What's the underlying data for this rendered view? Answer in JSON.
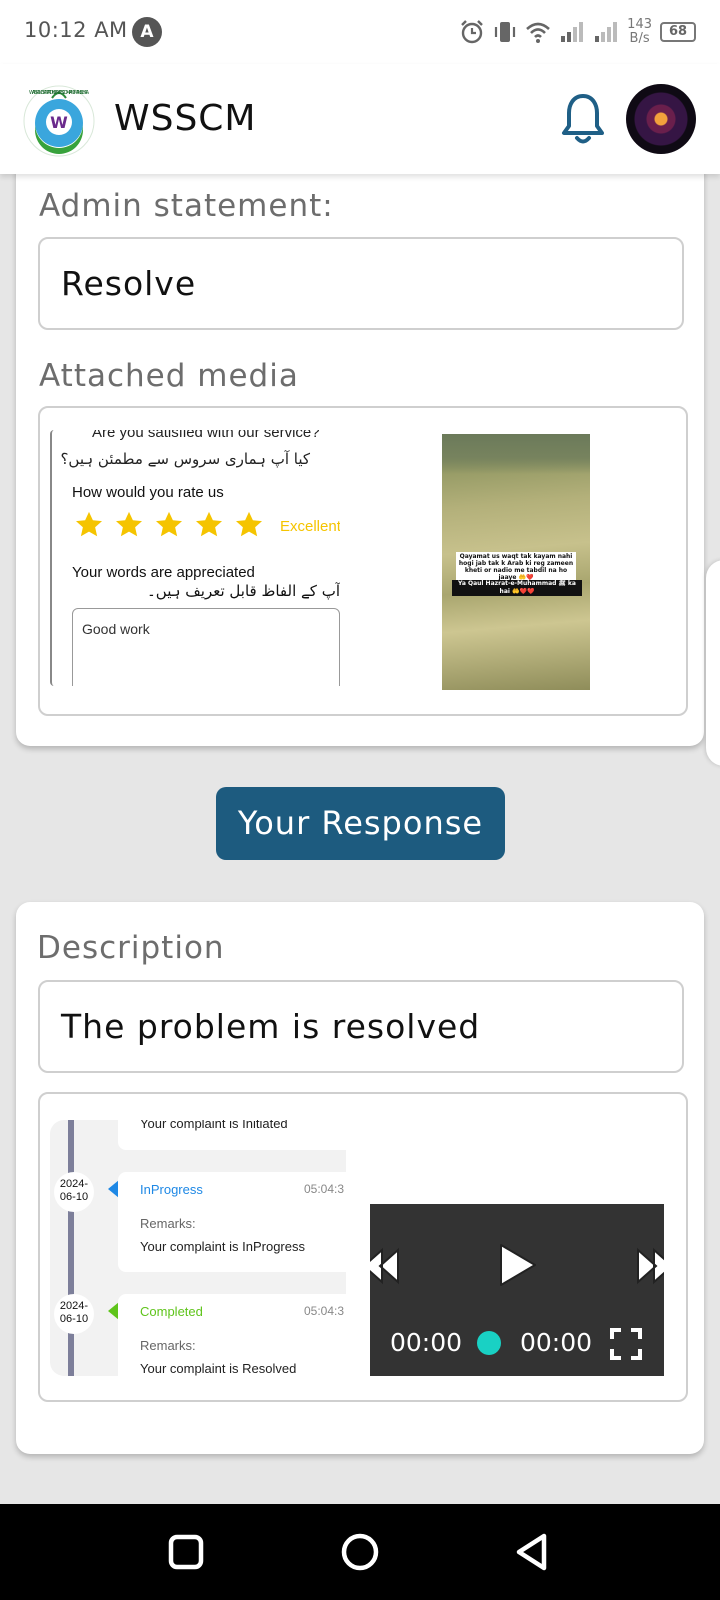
{
  "status_bar": {
    "time": "10:12 AM",
    "notification_letter": "A",
    "net_speed_value": "143",
    "net_speed_unit": "B/s",
    "battery": "68"
  },
  "app_bar": {
    "title": "WSSCM",
    "logo_letter": "W",
    "logo_ring_text": "WATER AND SANITATION SERVICES COMPANY MANSEHRA"
  },
  "complaint": {
    "admin_statement_label": "Admin statement:",
    "admin_statement_value": "Resolve",
    "attached_media_label": "Attached media"
  },
  "rating_screenshot": {
    "question": "Are you satisfied with our service?",
    "question_urdu": "کیا آپ ہماری سروس سے مطمئن ہیں؟",
    "rate_prompt": "How would you rate us",
    "stars": 5,
    "rating_text": "Excellent",
    "words_prompt": "Your words are appreciated",
    "words_urdu": "آپ کے الفاظ قابل تعریف ہیں۔",
    "feedback_text": "Good work"
  },
  "video_thumbnail": {
    "caption_1": "Qayamat us waqt tak kayam nahi hogi jab tak k Arab ki reg zameen kheti or nadio me tabdil na ho jaaye 🤲❤️",
    "caption_2": "Ya Qaul Hazrat-e-Muhammad ﷺ ka hai 🤲❤️❤️"
  },
  "response_button": {
    "label": "Your Response"
  },
  "response": {
    "description_label": "Description",
    "description_value": "The problem is resolved"
  },
  "timeline": [
    {
      "date": "",
      "status": "",
      "time": "",
      "remarks_label": "",
      "message": "Your complaint is Initiated"
    },
    {
      "date": "2024-06-10",
      "status": "InProgress",
      "time": "05:04:3",
      "remarks_label": "Remarks:",
      "message": "Your complaint is InProgress",
      "color": "#1e88e5"
    },
    {
      "date": "2024-06-10",
      "status": "Completed",
      "time": "05:04:3",
      "remarks_label": "Remarks:",
      "message": "Your complaint is Resolved",
      "color": "#5fc41b"
    }
  ],
  "player": {
    "current_time": "00:00",
    "duration": "00:00",
    "progress": 0
  },
  "colors": {
    "primary": "#1d5b7f",
    "accent": "#19d1c4",
    "star": "#f5c400",
    "inprogress": "#1e88e5",
    "completed": "#5fc41b"
  },
  "icons": [
    "bell-icon",
    "avatar",
    "play-icon",
    "skip-back-icon",
    "skip-forward-icon",
    "fullscreen-icon",
    "nav-recents-icon",
    "nav-home-icon",
    "nav-back-icon"
  ]
}
